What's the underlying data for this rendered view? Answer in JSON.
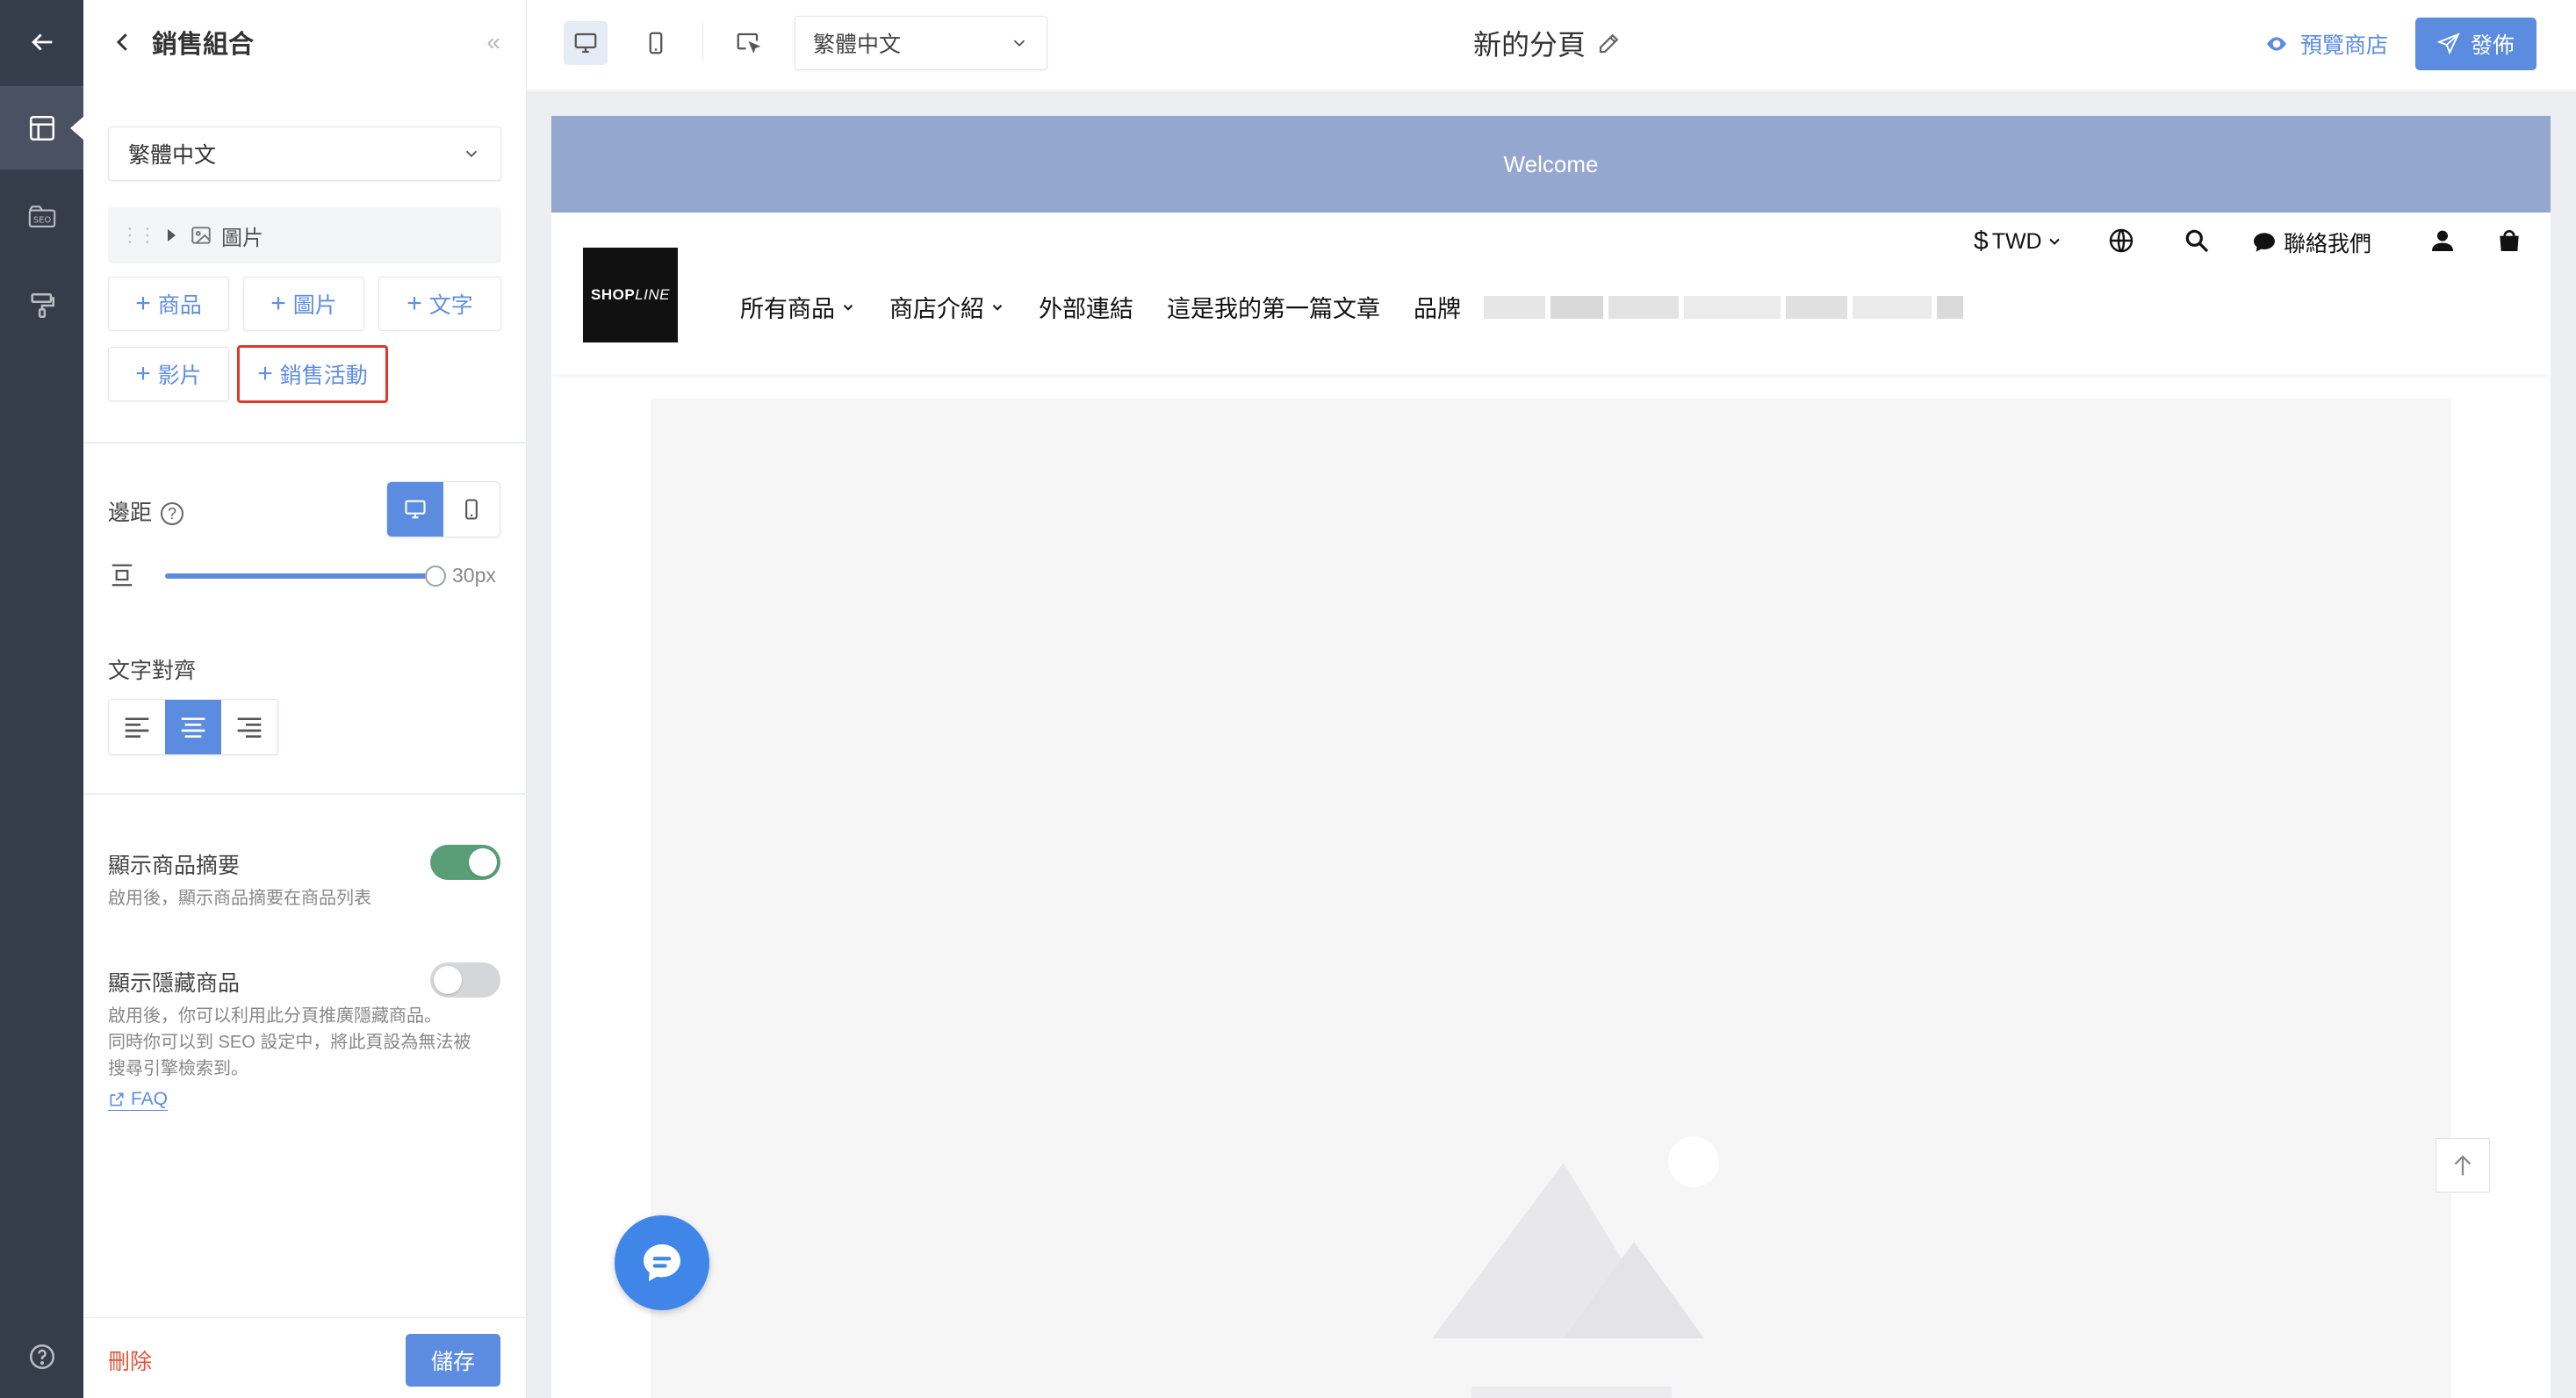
{
  "panel": {
    "title": "銷售組合",
    "language": "繁體中文",
    "tree_item": "圖片",
    "add_buttons": {
      "product": "商品",
      "image": "圖片",
      "text": "文字",
      "video": "影片",
      "promotion": "銷售活動"
    },
    "margin_label": "邊距",
    "margin_value": "30px",
    "margin_slider_fraction": 1.0,
    "text_align_label": "文字對齊",
    "text_align_selected": "center",
    "show_summary": {
      "label": "顯示商品摘要",
      "hint": "啟用後，顯示商品摘要在商品列表",
      "enabled": true
    },
    "show_hidden": {
      "label": "顯示隱藏商品",
      "hint_lines": [
        "啟用後，你可以利用此分頁推廣隱藏商品。",
        "同時你可以到 SEO 設定中，將此頁設為無法被",
        "搜尋引擎檢索到。"
      ],
      "enabled": false
    },
    "faq_label": "FAQ",
    "delete_label": "刪除",
    "save_label": "儲存"
  },
  "topbar": {
    "language": "繁體中文",
    "page_name": "新的分頁",
    "preview_label": "預覽商店",
    "publish_label": "發佈"
  },
  "store": {
    "welcome": "Welcome",
    "logo_bold": "SHOP",
    "logo_light": "LINE",
    "currency": "TWD",
    "currency_symbol": "$",
    "contact_label": "聯絡我們",
    "nav": [
      "所有商品",
      "商店介紹",
      "外部連結",
      "這是我的第一篇文章",
      "品牌"
    ]
  },
  "colors": {
    "accent": "#5b8ce0",
    "rail": "#363d4a",
    "welcome_bar": "#94a7cf",
    "toggle_on": "#5a9e78",
    "highlight_border": "#e0382f",
    "chat_fab": "#3f86e8"
  }
}
